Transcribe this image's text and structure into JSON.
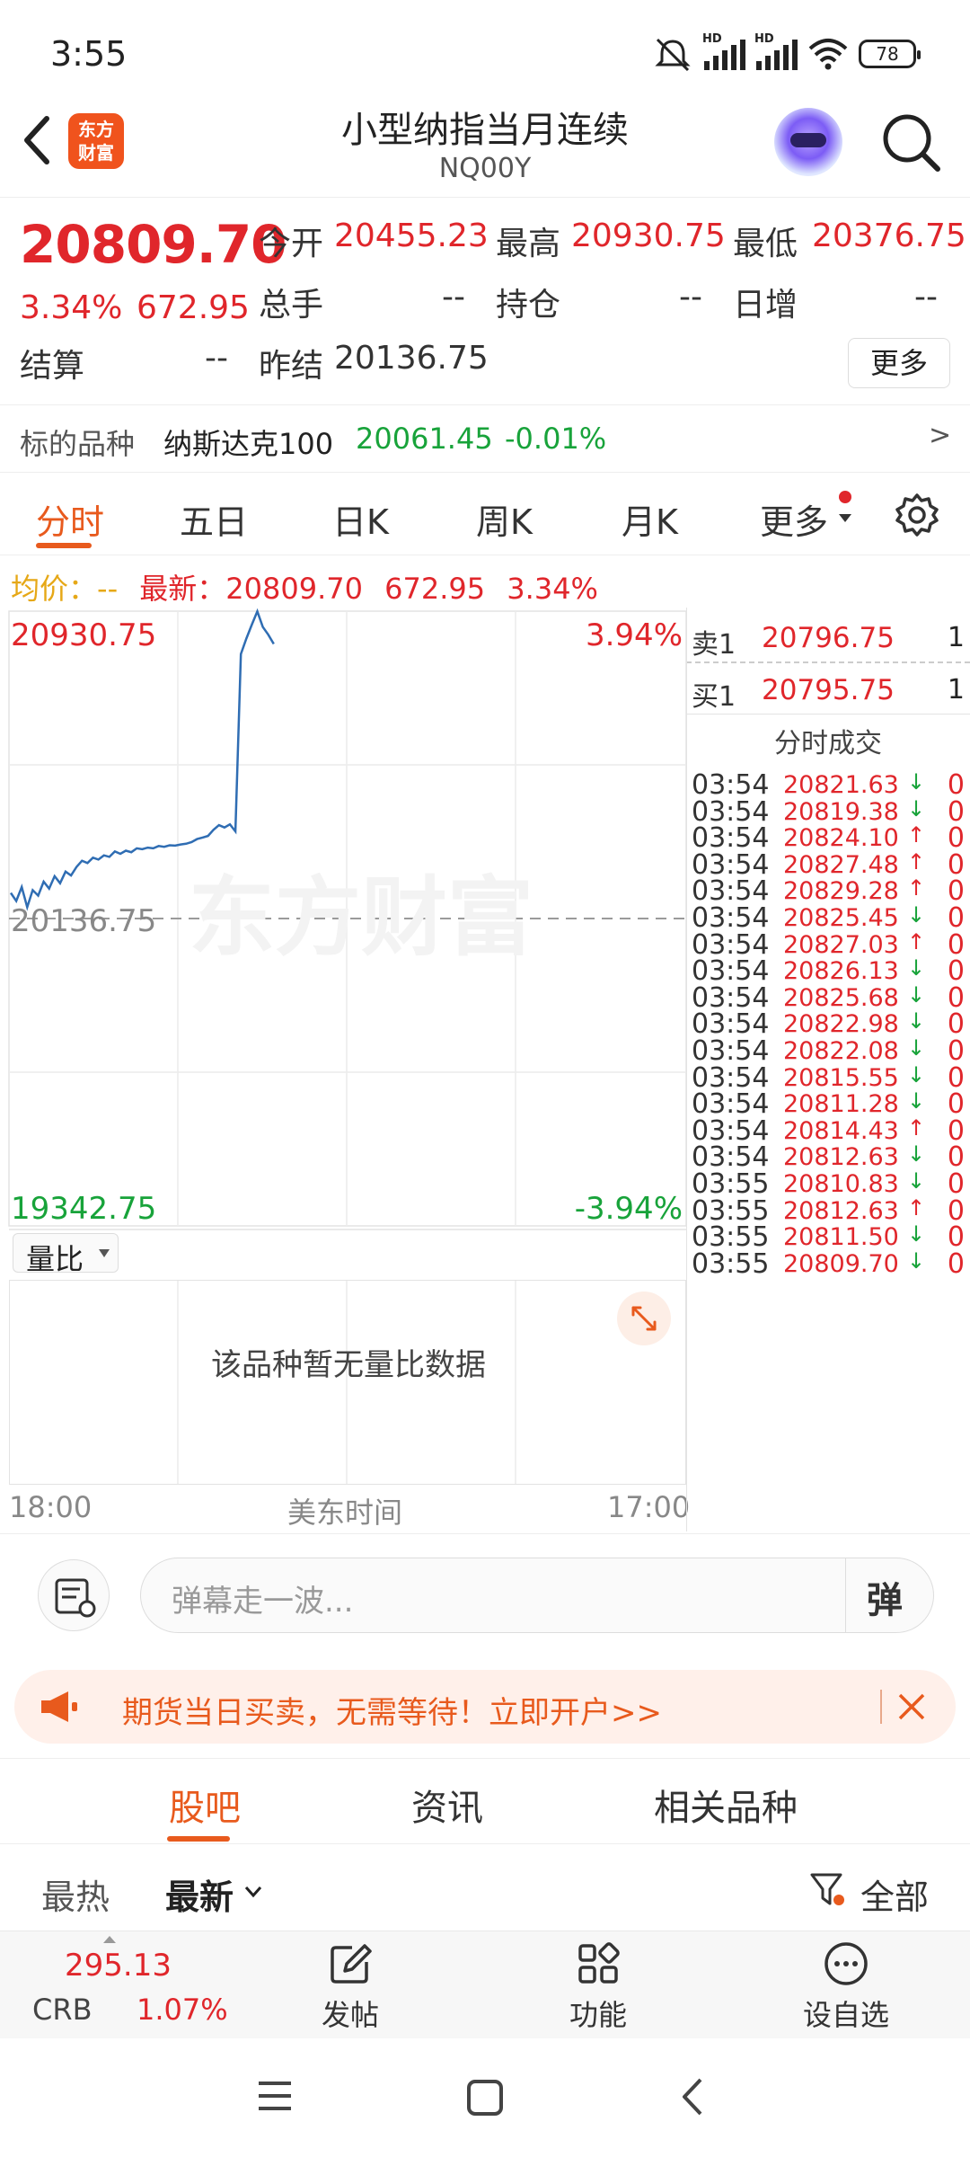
{
  "status": {
    "time": "3:55",
    "battery": "78",
    "hd1": "HD",
    "hd2": "HD"
  },
  "header": {
    "title": "小型纳指当月连续",
    "code": "NQ00Y",
    "logo_text": "东方\n财富"
  },
  "quote": {
    "last": "20809.70",
    "chg_pct": "3.34%",
    "chg_abs": "672.95",
    "open_label": "今开",
    "open": "20455.23",
    "high_label": "最高",
    "high": "20930.75",
    "low_label": "最低",
    "low": "20376.75",
    "vol_label": "总手",
    "vol": "--",
    "oi_label": "持仓",
    "oi": "--",
    "daily_inc_label": "日增",
    "daily_inc": "--",
    "settle_label": "结算",
    "settle": "--",
    "prev_settle_label": "昨结",
    "prev_settle": "20136.75",
    "more_label": "更多"
  },
  "underlying": {
    "label": "标的品种",
    "name": "纳斯达克100",
    "price": "20061.45",
    "chg": "-0.01%",
    "arrow": ">"
  },
  "tabs": [
    "分时",
    "五日",
    "日K",
    "周K",
    "月K",
    "更多"
  ],
  "avg": {
    "label": "均价：",
    "value": "--",
    "latest_label": "最新：",
    "latest": "20809.70",
    "chg_abs": "672.95",
    "chg_pct": "3.34%"
  },
  "chart": {
    "y_top": "20930.75",
    "y_mid": "20136.75",
    "y_bottom": "19342.75",
    "pct_top": "3.94%",
    "pct_bottom": "-3.94%",
    "x_start": "18:00",
    "x_mid": "美东时间",
    "x_end": "17:00",
    "watermark": "东方财富",
    "vol_selector": "量比",
    "no_data": "该品种暂无量比数据",
    "line_color": "#2f6db3",
    "prices": [
      20203,
      20182,
      20218,
      20166,
      20210,
      20196,
      20232,
      20214,
      20246,
      20228,
      20258,
      20248,
      20270,
      20286,
      20280,
      20294,
      20289,
      20300,
      20296,
      20310,
      20304,
      20312,
      20308,
      20318,
      20316,
      20320,
      20318,
      20324,
      20322,
      20326,
      20325,
      20328,
      20330,
      20334,
      20342,
      20346,
      20350,
      20366,
      20378,
      20372,
      20380,
      20362,
      20820,
      20860,
      20896,
      20930,
      20890,
      20870,
      20846
    ]
  },
  "book": {
    "sell_label": "卖1",
    "sell_price": "20796.75",
    "sell_vol": "1",
    "buy_label": "买1",
    "buy_price": "20795.75",
    "buy_vol": "1",
    "trades_title": "分时成交",
    "trades": [
      {
        "t": "03:54",
        "p": "20821.63",
        "d": "down",
        "v": "0"
      },
      {
        "t": "03:54",
        "p": "20819.38",
        "d": "down",
        "v": "0"
      },
      {
        "t": "03:54",
        "p": "20824.10",
        "d": "up",
        "v": "0"
      },
      {
        "t": "03:54",
        "p": "20827.48",
        "d": "up",
        "v": "0"
      },
      {
        "t": "03:54",
        "p": "20829.28",
        "d": "up",
        "v": "0"
      },
      {
        "t": "03:54",
        "p": "20825.45",
        "d": "down",
        "v": "0"
      },
      {
        "t": "03:54",
        "p": "20827.03",
        "d": "up",
        "v": "0"
      },
      {
        "t": "03:54",
        "p": "20826.13",
        "d": "down",
        "v": "0"
      },
      {
        "t": "03:54",
        "p": "20825.68",
        "d": "down",
        "v": "0"
      },
      {
        "t": "03:54",
        "p": "20822.98",
        "d": "down",
        "v": "0"
      },
      {
        "t": "03:54",
        "p": "20822.08",
        "d": "down",
        "v": "0"
      },
      {
        "t": "03:54",
        "p": "20815.55",
        "d": "down",
        "v": "0"
      },
      {
        "t": "03:54",
        "p": "20811.28",
        "d": "down",
        "v": "0"
      },
      {
        "t": "03:54",
        "p": "20814.43",
        "d": "up",
        "v": "0"
      },
      {
        "t": "03:54",
        "p": "20812.63",
        "d": "down",
        "v": "0"
      },
      {
        "t": "03:55",
        "p": "20810.83",
        "d": "down",
        "v": "0"
      },
      {
        "t": "03:55",
        "p": "20812.63",
        "d": "up",
        "v": "0"
      },
      {
        "t": "03:55",
        "p": "20811.50",
        "d": "down",
        "v": "0"
      },
      {
        "t": "03:55",
        "p": "20809.70",
        "d": "down",
        "v": "0"
      }
    ]
  },
  "comment": {
    "placeholder": "弹幕走一波...",
    "danmu_label": "弹"
  },
  "banner": {
    "text": "期货当日买卖，无需等待！立即开户>>"
  },
  "sub_tabs": [
    "股吧",
    "资讯",
    "相关品种"
  ],
  "sort": {
    "hot": "最热",
    "latest": "最新",
    "filter": "全部"
  },
  "bottom_nav": {
    "crb_value": "295.13",
    "crb_label": "CRB",
    "crb_chg": "1.07%",
    "post": "发帖",
    "func": "功能",
    "watch": "设自选"
  },
  "colors": {
    "up": "#e0262b",
    "down": "#18a33a",
    "accent": "#e85a1d"
  }
}
